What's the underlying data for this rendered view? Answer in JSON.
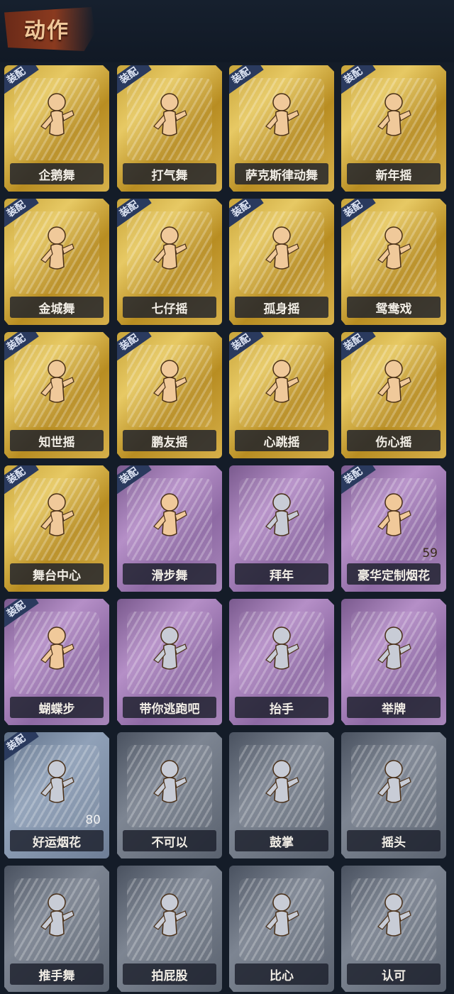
{
  "header": {
    "title": "动作"
  },
  "equip_badge": "装配",
  "colors": {
    "gold": "#d6b04a",
    "purple": "#a886ba",
    "blue": "#90a1b8",
    "grey": "#7d8592",
    "label_bg": "#1c202c",
    "figure_gold": "#f0c99a",
    "figure_grey": "#c8ccd6"
  },
  "emotes": [
    {
      "name": "企鹅舞",
      "tier": "gold",
      "equipped": true,
      "icon": "dance-figure-icon"
    },
    {
      "name": "打气舞",
      "tier": "gold",
      "equipped": true,
      "icon": "dance-figure-icon"
    },
    {
      "name": "萨克斯律动舞",
      "tier": "gold",
      "equipped": true,
      "icon": "dance-figure-icon"
    },
    {
      "name": "新年摇",
      "tier": "gold",
      "equipped": true,
      "icon": "dance-figure-icon"
    },
    {
      "name": "金城舞",
      "tier": "gold",
      "equipped": true,
      "icon": "dance-figure-icon"
    },
    {
      "name": "七仔摇",
      "tier": "gold",
      "equipped": true,
      "icon": "dance-figure-icon"
    },
    {
      "name": "孤身摇",
      "tier": "gold",
      "equipped": true,
      "icon": "dance-figure-icon"
    },
    {
      "name": "鸳鸯戏",
      "tier": "gold",
      "equipped": true,
      "icon": "dance-figure-icon"
    },
    {
      "name": "知世摇",
      "tier": "gold",
      "equipped": true,
      "icon": "dance-figure-icon"
    },
    {
      "name": "鹏友摇",
      "tier": "gold",
      "equipped": true,
      "icon": "dance-figure-icon"
    },
    {
      "name": "心跳摇",
      "tier": "gold",
      "equipped": true,
      "icon": "dance-figure-icon"
    },
    {
      "name": "伤心摇",
      "tier": "gold",
      "equipped": true,
      "icon": "heart-figure-icon"
    },
    {
      "name": "舞台中心",
      "tier": "gold",
      "equipped": true,
      "icon": "dance-figure-icon"
    },
    {
      "name": "滑步舞",
      "tier": "purple",
      "equipped": true,
      "icon": "dance-figure-icon"
    },
    {
      "name": "拜年",
      "tier": "purple",
      "equipped": false,
      "icon": "bow-figure-icon"
    },
    {
      "name": "豪华定制烟花",
      "tier": "purple",
      "equipped": true,
      "icon": "fireworks-icon",
      "count": "59"
    },
    {
      "name": "蝴蝶步",
      "tier": "purple",
      "equipped": true,
      "icon": "dance-figure-icon"
    },
    {
      "name": "带你逃跑吧",
      "tier": "purple",
      "equipped": false,
      "icon": "dance-figure-icon"
    },
    {
      "name": "抬手",
      "tier": "purple",
      "equipped": false,
      "icon": "wave-figure-icon"
    },
    {
      "name": "举牌",
      "tier": "purple",
      "equipped": false,
      "icon": "sign-figure-icon"
    },
    {
      "name": "好运烟花",
      "tier": "blue",
      "equipped": true,
      "icon": "firework-can-icon",
      "count": "80"
    },
    {
      "name": "不可以",
      "tier": "grey",
      "equipped": false,
      "icon": "finger-icon"
    },
    {
      "name": "鼓掌",
      "tier": "grey",
      "equipped": false,
      "icon": "clap-icon"
    },
    {
      "name": "摇头",
      "tier": "grey",
      "equipped": false,
      "icon": "shake-head-icon"
    },
    {
      "name": "推手舞",
      "tier": "grey",
      "equipped": false,
      "icon": "dance-figure-icon"
    },
    {
      "name": "拍屁股",
      "tier": "grey",
      "equipped": false,
      "icon": "dance-figure-icon"
    },
    {
      "name": "比心",
      "tier": "grey",
      "equipped": false,
      "icon": "finger-heart-icon"
    },
    {
      "name": "认可",
      "tier": "grey",
      "equipped": false,
      "icon": "thumbs-up-icon"
    }
  ]
}
